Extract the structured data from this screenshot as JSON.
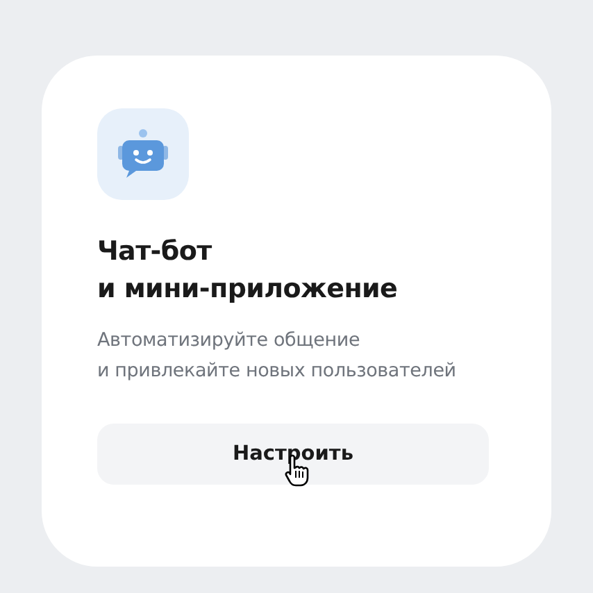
{
  "card": {
    "title_lines": [
      "Чат-бот",
      "и мини-приложение"
    ],
    "description_lines": [
      "Автоматизируйте общение",
      "и привлекайте новых пользователей"
    ],
    "button": {
      "label": "Настроить",
      "hovered": true
    }
  }
}
